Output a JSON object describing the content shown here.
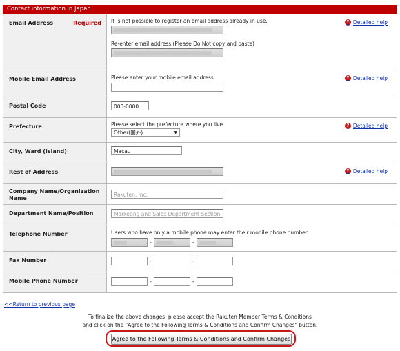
{
  "section_title": "Contact information in Japan",
  "help_link": "Detailed help",
  "help_icon": "question-circle-icon",
  "colors": {
    "header_bg": "#bf0000",
    "label_bg": "#f0f0f0",
    "link": "#1133aa",
    "highlight_border": "#c81818"
  },
  "email": {
    "label": "Email Address",
    "required": "Required",
    "note": "It is not possible to register an email address already in use.",
    "reenter_note": "Re-enter email address.(Please Do Not copy and paste)"
  },
  "mobile_email": {
    "label": "Mobile Email Address",
    "note": "Please enter your mobile email address."
  },
  "postal": {
    "label": "Postal Code",
    "value": "000-0000"
  },
  "prefecture": {
    "label": "Prefecture",
    "note": "Please select the prefecture where you live.",
    "selected": "Other(国外)"
  },
  "city": {
    "label": "City, Ward (Island)",
    "value": "Macau"
  },
  "rest_address": {
    "label": "Rest of Address"
  },
  "company": {
    "label": "Company Name/Organization Name",
    "value": "Rakuten, Inc."
  },
  "department": {
    "label": "Department Name/Position",
    "value": "Marketing and Sales Department  Section"
  },
  "telephone": {
    "label": "Telephone Number",
    "note": "Users who have only a mobile phone may enter their mobile phone number."
  },
  "fax": {
    "label": "Fax Number"
  },
  "mobile_phone": {
    "label": "Mobile Phone Number"
  },
  "dash": "-",
  "back_link": "<<Return to previous page",
  "finalize_line1": "To finalize the above changes, please accept the Rakuten Member Terms & Conditions",
  "finalize_line2": "and click on the \"Agree to the Following Terms & Conditions and Confirm Changes\" button.",
  "agree_button": "Agree to the Following Terms & Conditions and Confirm Changes"
}
